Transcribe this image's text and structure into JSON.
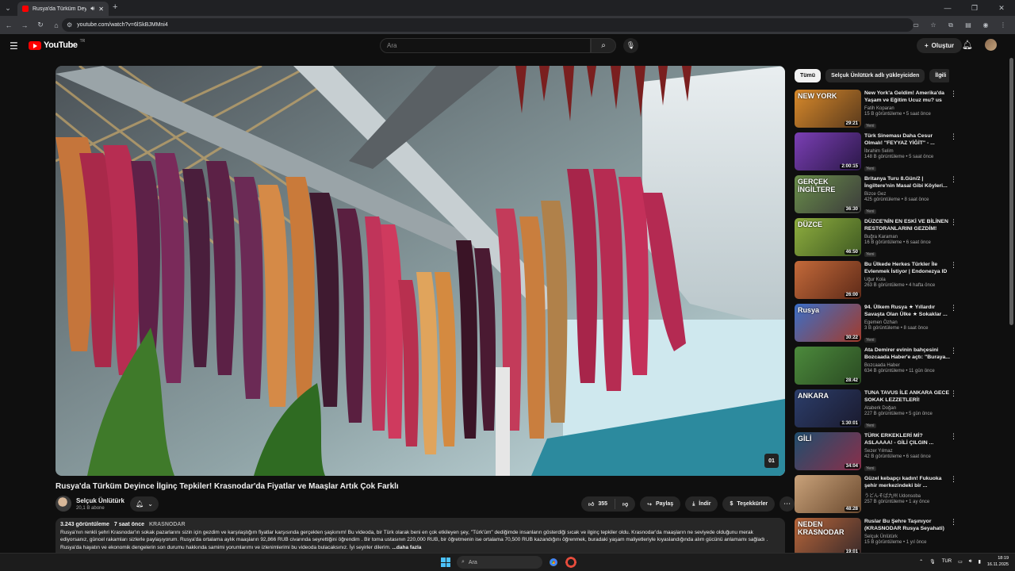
{
  "browser": {
    "tab_title": "Rusya'da Türküm Deyince İ",
    "url": "youtube.com/watch?v=6lSkBJMMni4"
  },
  "youtube": {
    "logo_text": "YouTube",
    "country_code": "TR",
    "search_placeholder": "Ara",
    "create_label": "Oluştur"
  },
  "video": {
    "title": "Rusya'da Türküm Deyince İlginç Tepkiler! Krasnodar'da Fiyatlar ve Maaşlar Artık Çok Farklı",
    "channel_name": "Selçuk Ünlütürk",
    "subscribers": "20,1 B abone",
    "likes": "355",
    "share_label": "Paylaş",
    "download_label": "İndir",
    "thanks_label": "Teşekkürler",
    "overlay_badge": "01",
    "views": "3.243 görüntüleme",
    "age": "7 saat önce",
    "location_tag": "KRASNODAR",
    "description": "Rusya'nın renkli şehri Krasnodar'ın sokak pazarlarını sizin için gezdim ve karşılaştığım fiyatlar karşısında gerçekten şaşkınım! Bu videoda, bir Türk olarak beni en çok etkileyen şey, \"Türk'üm\" dediğimde insanların gösterdiği sıcak ve ilginç tepkiler oldu. Krasnodar'da maaşların ne seviyede olduğunu merak ediyorsanız, güncel rakamları sizlerle paylaşıyorum. Rusya'da ortalama aylık maaşların 92,866 RUB civarında seyrettiğini öğrendim . Bir toma ustasının 220,000 RUB, bir öğretmenin ise ortalama 70,500 RUB kazandığını öğrenmek, buradaki yaşam maliyetleriyle kıyaslandığında alım gücünü anlamamı sağladı . Rusya'da hayatın ve ekonomik dengelerin son durumu hakkında samimi yorumlarımı ve izlenimlerimi bu videoda bulacaksınız. İyi seyirler dilerim.",
    "more_label": "...daha fazla"
  },
  "chips": [
    "Tümü",
    "Selçuk Ünlütürk adlı yükleyiciden",
    "İlgili"
  ],
  "recommendations": [
    {
      "title": "New York'a Geldim! Amerika'da Yaşam ve Eğitim Ucuz mu? us",
      "channel": "Fatih Koparan",
      "meta": "15 B görüntüleme • 5 saat önce",
      "duration": "29:21",
      "badge": "Yeni",
      "thumb_text": "NEW YORK",
      "color_a": "#d98a2b",
      "color_b": "#5a3a1c"
    },
    {
      "title": "Türk Sineması Daha Cesur Olmalı! \"FEYYAZ YİĞİT\" - ...",
      "channel": "İbrahim Selim",
      "meta": "148 B görüntüleme • 5 saat önce",
      "duration": "2:00:15",
      "badge": "Yeni",
      "thumb_text": "",
      "color_a": "#7b3fb5",
      "color_b": "#2b1848"
    },
    {
      "title": "Britanya Turu 8.Gün/2 | İngiltere'nin Masal Gibi Köyleri...",
      "channel": "Bizce Gez",
      "meta": "425 görüntüleme • 8 saat önce",
      "duration": "36:30",
      "badge": "Yeni",
      "thumb_text": "GERÇEK İNGİLTERE",
      "color_a": "#6a8f4a",
      "color_b": "#3b3b3b"
    },
    {
      "title": "DÜZCE'NİN EN ESKİ VE BİLİNEN RESTORANLARINI GEZDİM!",
      "channel": "Buğra Karaman",
      "meta": "16 B görüntüleme • 6 saat önce",
      "duration": "46:50",
      "badge": "Yeni",
      "thumb_text": "DÜZCE",
      "color_a": "#8fae3f",
      "color_b": "#3f5a22"
    },
    {
      "title": "Bu Ülkede Herkes Türkler İle Evlenmek İstiyor | Endonezya ID",
      "channel": "Uğur Kola",
      "meta": "263 B görüntüleme • 4 hafta önce",
      "duration": "26:00",
      "badge": "",
      "thumb_text": "",
      "color_a": "#c46a3a",
      "color_b": "#5e2a18"
    },
    {
      "title": "94. Ülkem Rusya ★ Yıllardır Savaşta Olan Ülke ★ Sokaklar ...",
      "channel": "Egemen Özhan",
      "meta": "3 B görüntüleme • 8 saat önce",
      "duration": "30:22",
      "badge": "Yeni",
      "thumb_text": "Rusya",
      "color_a": "#3a6fc8",
      "color_b": "#a33b2b"
    },
    {
      "title": "Ata Demirer evinin bahçesini Bozcaada Haber'e açtı: \"Buraya...",
      "channel": "Bozcaada Haber",
      "meta": "634 B görüntüleme • 11 gün önce",
      "duration": "28:42",
      "badge": "",
      "thumb_text": "",
      "color_a": "#4c8a3c",
      "color_b": "#2a4a22"
    },
    {
      "title": "TUNA TAVUS İLE ANKARA GECE SOKAK LEZZETLERİ!",
      "channel": "Ataberk Doğan",
      "meta": "227 B görüntüleme • 5 gün önce",
      "duration": "1:30:01",
      "badge": "Yeni",
      "thumb_text": "ANKARA",
      "color_a": "#2c3e6b",
      "color_b": "#1a1a2e"
    },
    {
      "title": "TÜRK ERKEKLERİ Mİ? ASLAAAA! - GİLİ ÇILGIN ...",
      "channel": "Sezer Yılmaz",
      "meta": "42 B görüntüleme • 6 saat önce",
      "duration": "34:04",
      "badge": "Yeni",
      "thumb_text": "GİLİ",
      "color_a": "#1f4e6e",
      "color_b": "#8a2f4a"
    },
    {
      "title": "Güzel kebapçı kadın! Fukuoka şehir merkezindeki bir ...",
      "channel": "うどんそば九州 Udonsoba",
      "meta": "257 B görüntüleme • 1 ay önce",
      "duration": "48:28",
      "badge": "",
      "thumb_text": "",
      "color_a": "#c9a27a",
      "color_b": "#6b4a2f"
    },
    {
      "title": "Ruslar Bu Şehre Taşınıyor (KRASNODAR Rusya Seyahati)",
      "channel": "Selçuk Ünlütürk",
      "meta": "15 B görüntüleme • 1 yıl önce",
      "duration": "19:01",
      "badge": "",
      "thumb_text": "NEDEN KRASNODAR",
      "color_a": "#b8663a",
      "color_b": "#3a2a2a"
    }
  ],
  "taskbar": {
    "search_placeholder": "Ara",
    "lang": "TUR",
    "time": "18:19",
    "date": "16.11.2025"
  }
}
